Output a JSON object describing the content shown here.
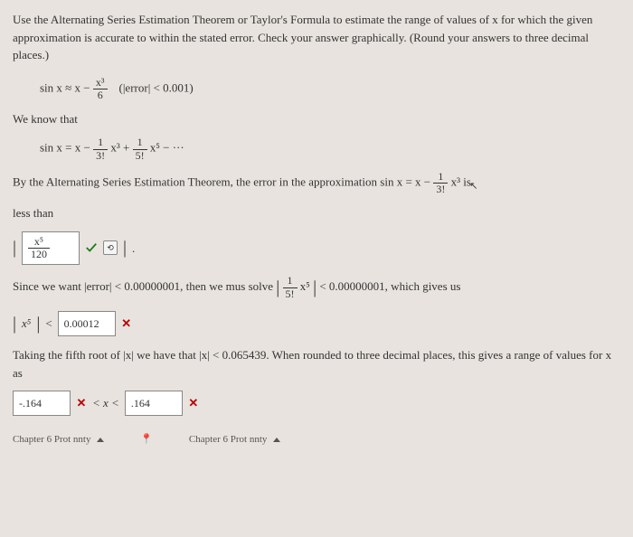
{
  "intro": "Use the Alternating Series Estimation Theorem or Taylor's Formula to estimate the range of values of x for which the given approximation is accurate to within the stated error. Check your answer graphically. (Round your answers to three decimal places.)",
  "approx": {
    "lhs": "sin x ≈ x −",
    "frac_num": "x³",
    "frac_den": "6",
    "err": "(|error| < 0.001)"
  },
  "know": "We know that",
  "series": {
    "lhs": "sin x = x −",
    "f1_num": "1",
    "f1_den": "3!",
    "mid1": "x³ +",
    "f2_num": "1",
    "f2_den": "5!",
    "mid2": "x⁵ − ···"
  },
  "thm": {
    "pre": "By the Alternating Series Estimation Theorem, the error in the approximation sin x = x −",
    "f_num": "1",
    "f_den": "3!",
    "post": "x³ is"
  },
  "lessthan": "less than",
  "answer1": {
    "frac_num": "x⁵",
    "frac_den": "120",
    "pipe_r": "."
  },
  "since": {
    "pre": "Since we want |error| < 0.00000001, then we mus solve",
    "f_num": "1",
    "f_den": "5!",
    "mid": "x⁵",
    "post": "< 0.00000001, which gives us"
  },
  "answer2": {
    "lhs_exp": "x⁵",
    "lt": "<",
    "value": "0.00012"
  },
  "taking": "Taking the fifth root of |x| we have that |x| < 0.065439. When rounded to three decimal places, this gives a range of values for x as",
  "answer3": {
    "left_val": "-.164",
    "mid": "< x <",
    "right_val": ".164"
  },
  "footer_left": "Chapter 6  Prot    nnty",
  "footer_right": "Chapter 6  Prot    nnty"
}
